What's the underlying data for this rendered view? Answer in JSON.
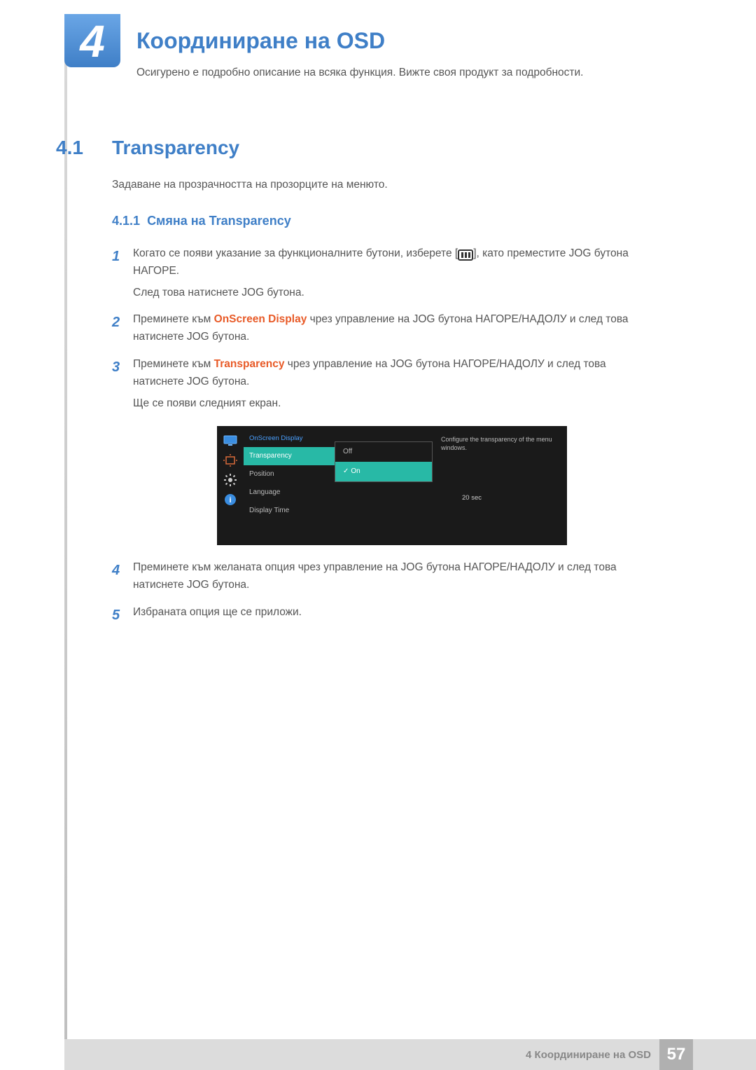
{
  "chapter": {
    "number": "4",
    "title": "Координиране на OSD",
    "description": "Осигурено е подробно описание на всяка функция. Вижте своя продукт за подробности."
  },
  "section": {
    "number": "4.1",
    "title": "Transparency",
    "description": "Задаване на прозрачността на прозорците на менюто."
  },
  "subsection": {
    "number": "4.1.1",
    "title": "Смяна на Transparency"
  },
  "steps": {
    "s1": {
      "num": "1",
      "t1": "Когато се появи указание за функционалните бутони, изберете [",
      "t2": "], като преместите JOG бутона НАГОРЕ.",
      "extra": "След това натиснете JOG бутона."
    },
    "s2": {
      "num": "2",
      "t1": "Преминете към ",
      "hl": "OnScreen Display",
      "t2": " чрез управление на JOG бутона НАГОРЕ/НАДОЛУ и след това натиснете JOG бутона."
    },
    "s3": {
      "num": "3",
      "t1": "Преминете към ",
      "hl": "Transparency",
      "t2": " чрез управление на JOG бутона НАГОРЕ/НАДОЛУ и след това натиснете JOG бутона.",
      "extra": "Ще се появи следният екран."
    },
    "s4": {
      "num": "4",
      "text": "Преминете към желаната опция чрез управление на JOG бутона НАГОРЕ/НАДОЛУ и след това натиснете JOG бутона."
    },
    "s5": {
      "num": "5",
      "text": "Избраната опция ще се приложи."
    }
  },
  "osd": {
    "heading": "OnScreen Display",
    "rows": {
      "transparency": "Transparency",
      "position": "Position",
      "language": "Language",
      "display_time": "Display Time"
    },
    "options": {
      "off": "Off",
      "on": "On"
    },
    "display_time_value": "20 sec",
    "help": "Configure the transparency of the menu windows."
  },
  "footer": {
    "text": "4 Координиране на OSD",
    "page": "57"
  }
}
